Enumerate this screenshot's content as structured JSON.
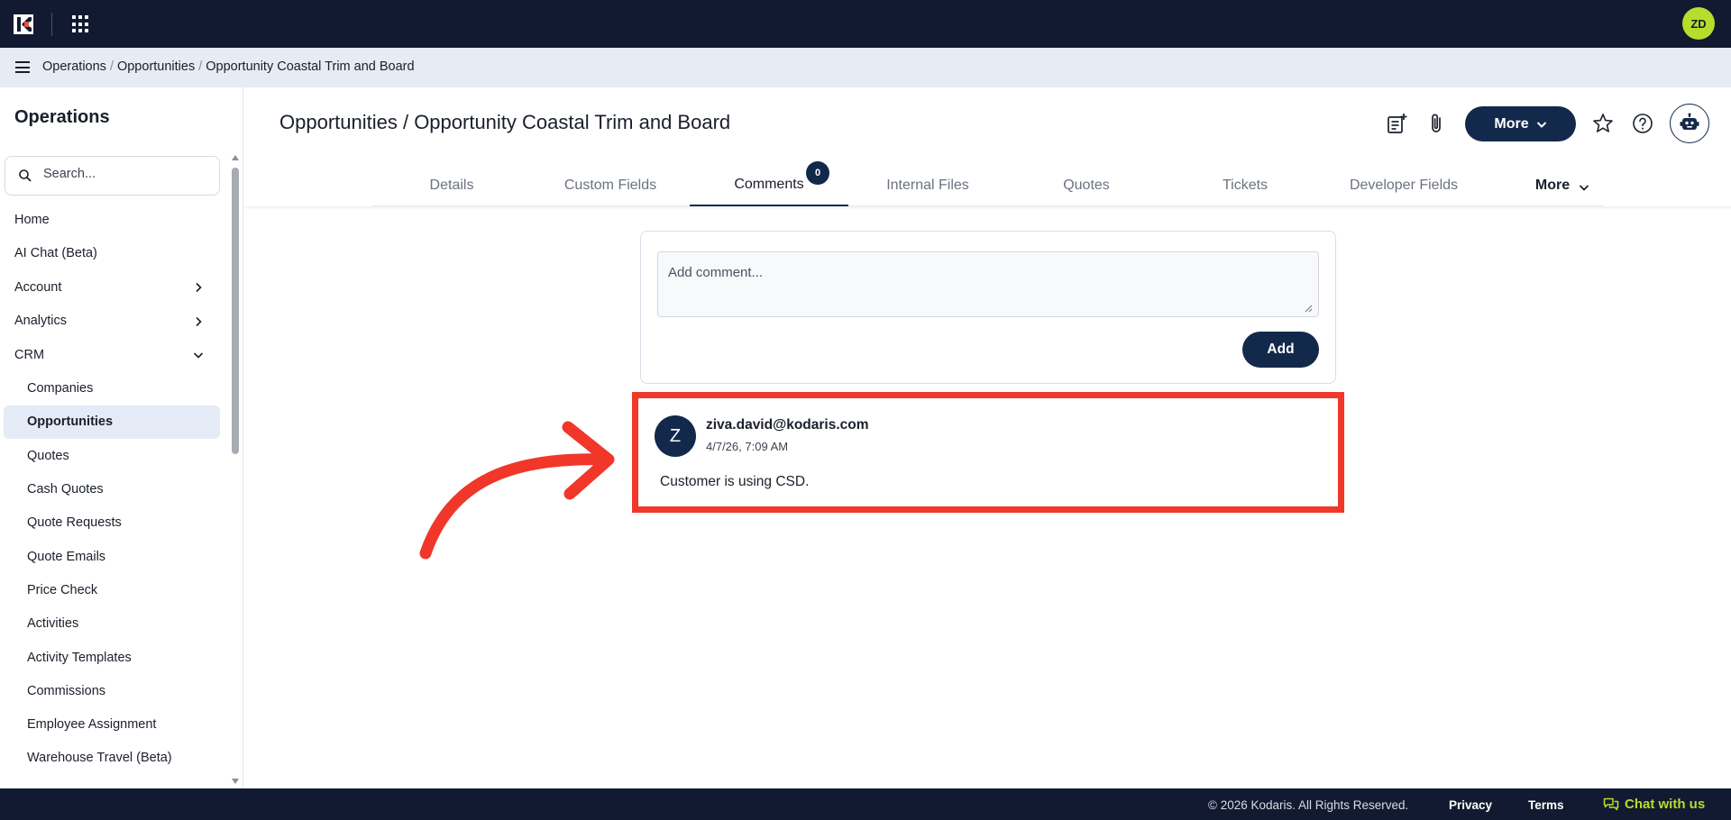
{
  "topbar": {
    "user_initials": "ZD"
  },
  "breadcrumb": {
    "items": [
      "Operations",
      "Opportunities",
      "Opportunity Coastal Trim and Board"
    ],
    "separator": "/"
  },
  "sidebar": {
    "title": "Operations",
    "search_placeholder": "Search...",
    "items": [
      {
        "label": "Home"
      },
      {
        "label": "AI Chat (Beta)"
      },
      {
        "label": "Account"
      },
      {
        "label": "Analytics"
      },
      {
        "label": "CRM"
      }
    ],
    "crm_items": [
      {
        "label": "Companies"
      },
      {
        "label": "Opportunities"
      },
      {
        "label": "Quotes"
      },
      {
        "label": "Cash Quotes"
      },
      {
        "label": "Quote Requests"
      },
      {
        "label": "Quote Emails"
      },
      {
        "label": "Price Check"
      },
      {
        "label": "Activities"
      },
      {
        "label": "Activity Templates"
      },
      {
        "label": "Commissions"
      },
      {
        "label": "Employee Assignment"
      },
      {
        "label": "Warehouse Travel (Beta)"
      }
    ]
  },
  "page": {
    "title": "Opportunities / Opportunity Coastal Trim and Board",
    "more_label": "More"
  },
  "tabs": {
    "items": [
      {
        "label": "Details"
      },
      {
        "label": "Custom Fields"
      },
      {
        "label": "Comments",
        "badge": "0"
      },
      {
        "label": "Internal Files"
      },
      {
        "label": "Quotes"
      },
      {
        "label": "Tickets"
      },
      {
        "label": "Developer Fields"
      },
      {
        "label": "More"
      }
    ],
    "active": "Comments"
  },
  "comment_form": {
    "placeholder": "Add comment...",
    "add_label": "Add"
  },
  "comments": [
    {
      "avatar_initial": "Z",
      "author": "ziva.david@kodaris.com",
      "timestamp": "4/7/26, 7:09 AM",
      "body": "Customer is using CSD."
    }
  ],
  "annotation": {
    "highlight_color": "#f0372a"
  },
  "footer": {
    "copyright": "© 2026 Kodaris. All Rights Reserved.",
    "privacy": "Privacy",
    "terms": "Terms",
    "chat": "Chat with us"
  },
  "colors": {
    "navy": "#121a31",
    "primary": "#13294b",
    "accent_green": "#b7dd2c"
  }
}
